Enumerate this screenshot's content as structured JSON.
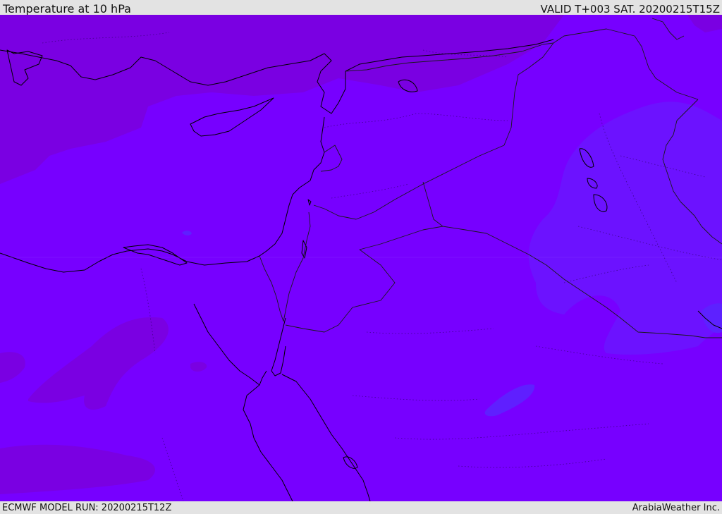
{
  "header": {
    "title": "Temperature at 10 hPa",
    "valid_time": "VALID T+003 SAT. 20200215T15Z"
  },
  "footer": {
    "model_run": "ECMWF MODEL RUN: 20200215T12Z",
    "credit": "ArabiaWeather Inc."
  },
  "map": {
    "background_color": "#7700ff",
    "warm_shade_color": "#7a00dd",
    "cool_shade_color": "#6a14ff",
    "cold_spot_color": "#5a24ff",
    "coastline_color": "#000000",
    "border_color": "#1a1a1a"
  }
}
